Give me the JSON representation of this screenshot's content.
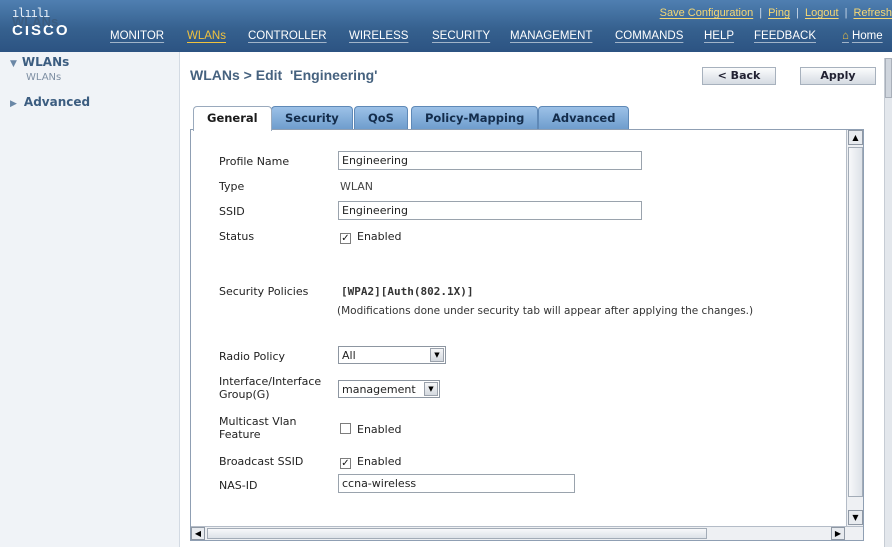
{
  "brand": {
    "bars": "ılıılı",
    "word": "CISCO"
  },
  "utility": {
    "save_config": "Save Configuration",
    "ping": "Ping",
    "logout": "Logout",
    "refresh": "Refresh"
  },
  "nav": {
    "monitor": "MONITOR",
    "wlans": "WLANs",
    "controller": "CONTROLLER",
    "wireless": "WIRELESS",
    "security": "SECURITY",
    "management": "MANAGEMENT",
    "commands": "COMMANDS",
    "help": "HELP",
    "feedback": "FEEDBACK",
    "home": "Home",
    "active_color": "#f0c23e"
  },
  "sidebar": {
    "title": "WLANs",
    "items": [
      {
        "label": "WLANs",
        "expanded": true
      },
      {
        "label": "WLANs",
        "sub": true
      },
      {
        "label": "Advanced",
        "expanded": false
      }
    ]
  },
  "page": {
    "title": "WLANs > Edit  'Engineering'",
    "back_label": "< Back",
    "apply_label": "Apply"
  },
  "tabs": [
    {
      "label": "General",
      "selected": true
    },
    {
      "label": "Security"
    },
    {
      "label": "QoS"
    },
    {
      "label": "Policy-Mapping"
    },
    {
      "label": "Advanced"
    }
  ],
  "form": {
    "profile_name": {
      "label": "Profile Name",
      "value": "Engineering"
    },
    "type": {
      "label": "Type",
      "value": "WLAN"
    },
    "ssid": {
      "label": "SSID",
      "value": "Engineering"
    },
    "status": {
      "label": "Status",
      "checkbox_label": "Enabled",
      "checked": true
    },
    "security_policies": {
      "label": "Security Policies",
      "value": "[WPA2][Auth(802.1X)]",
      "note": "(Modifications done under security tab will appear after applying the changes.)"
    },
    "radio_policy": {
      "label": "Radio Policy",
      "value": "All"
    },
    "interface_group": {
      "label_line1": "Interface/Interface",
      "label_line2": "Group(G)",
      "value": "management"
    },
    "multicast_vlan": {
      "label_line1": "Multicast Vlan",
      "label_line2": "Feature",
      "checkbox_label": "Enabled",
      "checked": false
    },
    "broadcast_ssid": {
      "label": "Broadcast SSID",
      "checkbox_label": "Enabled",
      "checked": true
    },
    "nas_id": {
      "label": "NAS-ID",
      "value": "ccna-wireless"
    }
  }
}
